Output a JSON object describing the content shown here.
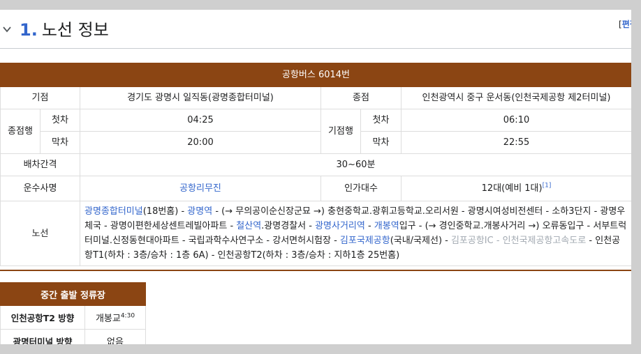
{
  "section": {
    "number": "1.",
    "title": "노선 정보",
    "edit_label": "편집",
    "edit_bracket_open": "["
  },
  "route_table": {
    "header": "공항버스 6014번",
    "start_label": "기점",
    "start_value": "경기도 광명시 일직동(광명종합터미널)",
    "end_label": "종점",
    "end_value": "인천광역시 중구 운서동(인천국제공항 제2터미널)",
    "from_end_label": "종점행",
    "from_start_label": "기점행",
    "first_label": "첫차",
    "last_label": "막차",
    "end_first": "04:25",
    "end_last": "20:00",
    "start_first": "06:10",
    "start_last": "22:55",
    "interval_label": "배차간격",
    "interval_value": "30~60분",
    "operator_label": "운수사명",
    "operator_value": "공항리무진",
    "fleet_label": "인가대수",
    "fleet_value": "12대(예비 1대)",
    "fleet_ref": "[1]",
    "route_label": "노선",
    "route_segments": [
      {
        "t": "광명종합터미널",
        "c": "lnk"
      },
      {
        "t": "(18번홈) - ",
        "c": ""
      },
      {
        "t": "광명역",
        "c": "lnk"
      },
      {
        "t": " - (→ 무의공이순신장군묘 →) 충현중학교.광휘고등학교.오리서원 - 광명시여성비전센터 - 소하3단지 - 광명우체국 - 광명이편한세상센트레빌아파트 - ",
        "c": ""
      },
      {
        "t": "철산역",
        "c": "lnk"
      },
      {
        "t": ".광명경찰서 - ",
        "c": ""
      },
      {
        "t": "광명사거리역",
        "c": "lnk"
      },
      {
        "t": " - ",
        "c": ""
      },
      {
        "t": "개봉역",
        "c": "lnk"
      },
      {
        "t": "입구 - (→ 경인중학교.개봉사거리 →) 오류동입구 - 서부트럭터미널.신정동현대아파트 - 국립과학수사연구소 - 강서면허시험장 - ",
        "c": ""
      },
      {
        "t": "김포국제공항",
        "c": "lnk"
      },
      {
        "t": "(국내/국제선) - ",
        "c": ""
      },
      {
        "t": "김포공항IC - 인천국제공항고속도로",
        "c": "dim"
      },
      {
        "t": " - 인천공항T1(하차 : 3층/승차 : 1층 6A) - 인천공항T2(하차 : 3층/승차 : 지하1층 25번홈)",
        "c": ""
      }
    ]
  },
  "stops_table": {
    "header": "중간 출발 정류장",
    "rows": [
      {
        "direction": "인천공항T2 방향",
        "value": "개봉교",
        "sup": "4:30"
      },
      {
        "direction": "광명터미널 방향",
        "value": "없음",
        "sup": ""
      }
    ]
  },
  "colors": {
    "accent_brown": "#8b4513",
    "link_blue": "#3366cc",
    "dim_link": "#a2a9b1"
  }
}
